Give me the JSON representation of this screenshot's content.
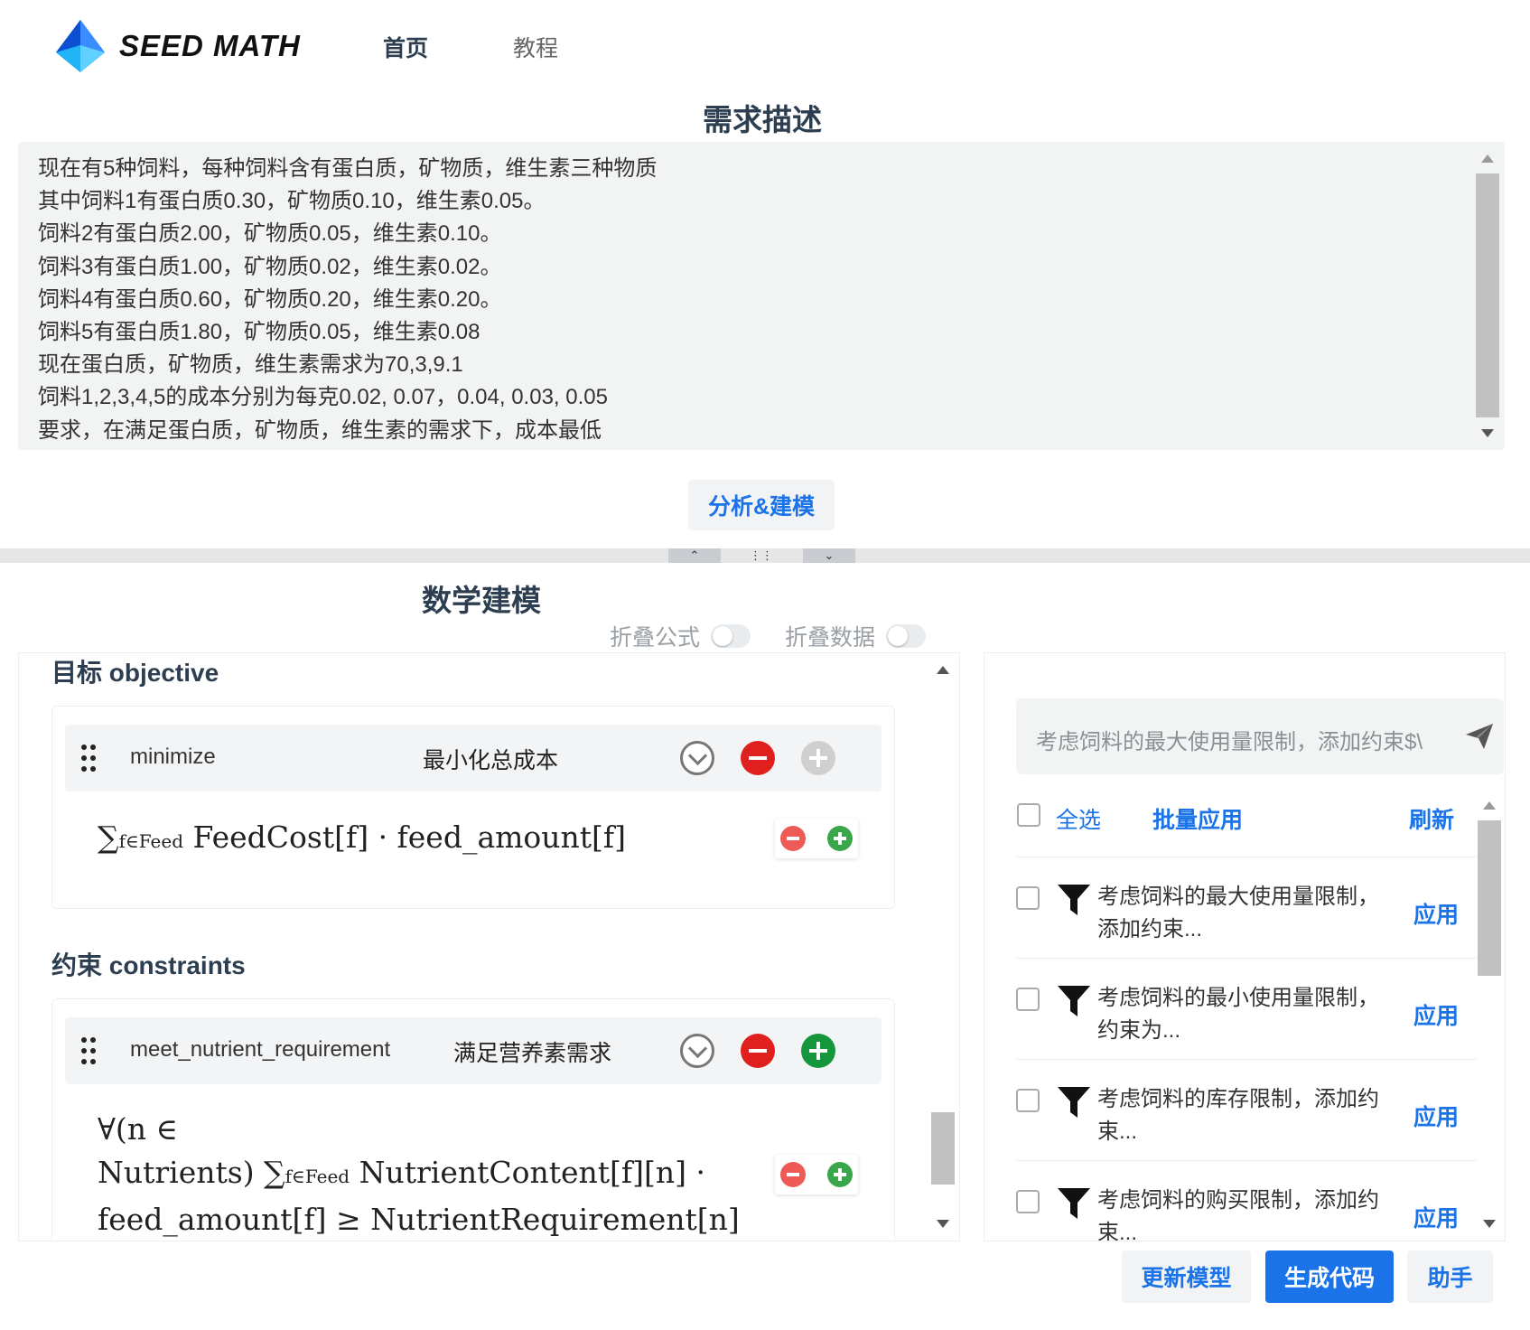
{
  "brand": {
    "name": "SEED MATH"
  },
  "nav": {
    "home": "首页",
    "tutorial": "教程"
  },
  "requirement": {
    "title": "需求描述",
    "lines": [
      "现在有5种饲料，每种饲料含有蛋白质，矿物质，维生素三种物质",
      "其中饲料1有蛋白质0.30，矿物质0.10，维生素0.05。",
      "饲料2有蛋白质2.00，矿物质0.05，维生素0.10。",
      "饲料3有蛋白质1.00，矿物质0.02，维生素0.02。",
      "饲料4有蛋白质0.60，矿物质0.20，维生素0.20。",
      "饲料5有蛋白质1.80，矿物质0.05，维生素0.08",
      "现在蛋白质，矿物质，维生素需求为70,3,9.1",
      "饲料1,2,3,4,5的成本分别为每克0.02, 0.07，0.04, 0.03, 0.05",
      "要求，在满足蛋白质，矿物质，维生素的需求下，成本最低"
    ]
  },
  "analyze_button": "分析&建模",
  "modeling": {
    "title": "数学建模",
    "fold_formula": "折叠公式",
    "fold_data": "折叠数据",
    "objective_heading": "目标 objective",
    "constraints_heading": "约束 constraints",
    "objective": {
      "name": "minimize",
      "desc": "最小化总成本",
      "formula": {
        "sum": "∑",
        "sub": "f∈Feed",
        "body": "FeedCost[f] · feed_amount[f]"
      }
    },
    "constraint": {
      "name": "meet_nutrient_requirement",
      "desc": "满足营养素需求",
      "formula": {
        "line1": "∀(n ∈",
        "line2_pre": "Nutrients) ∑",
        "sub": "f∈Feed",
        "line2_post": "NutrientContent[f][n] ·",
        "line3": "feed_amount[f] ≥ NutrientRequirement[n]"
      }
    }
  },
  "assistant": {
    "prompt": "考虑饲料的最大使用量限制，添加约束$\\",
    "select_all": "全选",
    "batch_apply": "批量应用",
    "refresh": "刷新",
    "apply_label": "应用",
    "suggestions": [
      {
        "line1": "考虑饲料的最大使用量限制，",
        "line2": "添加约束..."
      },
      {
        "line1": "考虑饲料的最小使用量限制，",
        "line2": "约束为..."
      },
      {
        "line1": "考虑饲料的库存限制，添加约",
        "line2": "束..."
      },
      {
        "line1": "考虑饲料的购买限制，添加约",
        "line2": "束..."
      }
    ]
  },
  "footer": {
    "update_model": "更新模型",
    "generate_code": "生成代码",
    "helper": "助手"
  },
  "colors": {
    "accent": "#1a73e8",
    "danger": "#e0201e",
    "success": "#15963c",
    "panel_bg": "#f2f4f3"
  }
}
